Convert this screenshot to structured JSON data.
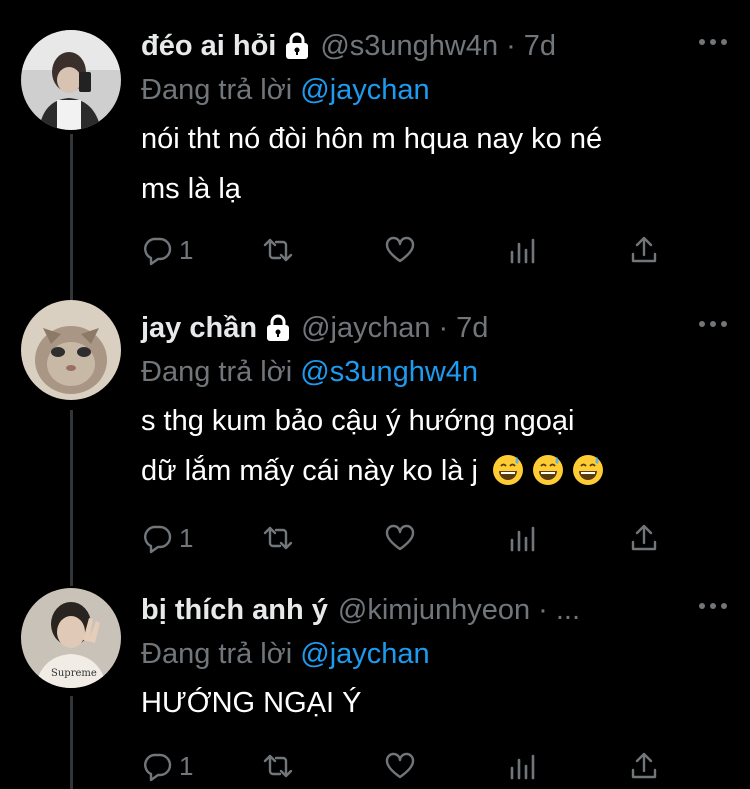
{
  "tweets": [
    {
      "name": "đéo ai hỏi",
      "handle": "@s3unghw4n",
      "separator": "·",
      "time": "7d",
      "reply_prefix": "Đang trả lời",
      "reply_to": "@jaychan",
      "text_lines": [
        "nói tht nó đòi hôn m hqua nay ko né",
        "ms là lạ"
      ],
      "reply_count": "1",
      "protected": true
    },
    {
      "name": "jay chần",
      "handle": "@jaychan",
      "separator": "·",
      "time": "7d",
      "reply_prefix": "Đang trả lời",
      "reply_to": "@s3unghw4n",
      "text_lines": [
        "s thg kum bảo cậu ý hướng ngoại",
        "dữ lắm mấy cái này ko là j"
      ],
      "emoji_count": 3,
      "reply_count": "1",
      "protected": true
    },
    {
      "name": "bị thích anh ý",
      "handle": "@kimjunhyeon",
      "separator": "·",
      "time": "...",
      "reply_prefix": "Đang trả lời",
      "reply_to": "@jaychan",
      "text_lines": [
        "HƯỚNG NGẠI Ý"
      ],
      "reply_count": "1",
      "protected": false
    }
  ],
  "icons": {
    "reply": "reply-icon",
    "retweet": "retweet-icon",
    "like": "like-icon",
    "analytics": "analytics-icon",
    "share": "share-icon",
    "more": "more-icon",
    "lock": "lock-icon",
    "emoji": "grinning-sweat-emoji"
  },
  "colors": {
    "background": "#000000",
    "text": "#ffffff",
    "muted": "#71767b",
    "mention": "#1d9bf0",
    "thread_line": "#333639"
  }
}
